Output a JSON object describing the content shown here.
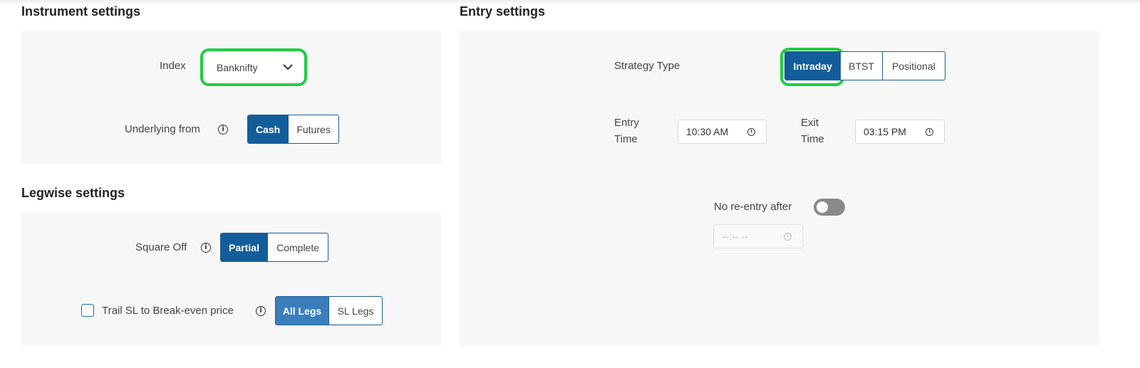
{
  "instrument": {
    "title": "Instrument settings",
    "index_label": "Index",
    "index_value": "Banknifty",
    "underlying_label": "Underlying from",
    "underlying_options": [
      "Cash",
      "Futures"
    ],
    "underlying_selected": "Cash"
  },
  "legwise": {
    "title": "Legwise settings",
    "square_off_label": "Square Off",
    "square_off_options": [
      "Partial",
      "Complete"
    ],
    "square_off_selected": "Partial",
    "trail_label": "Trail SL to Break-even price",
    "trail_checked": false,
    "trail_options": [
      "All Legs",
      "SL Legs"
    ],
    "trail_selected": "All Legs"
  },
  "entry": {
    "title": "Entry settings",
    "strategy_label": "Strategy Type",
    "strategy_options": [
      "Intraday",
      "BTST",
      "Positional"
    ],
    "strategy_selected": "Intraday",
    "entry_time_label_1": "Entry",
    "entry_time_label_2": "Time",
    "entry_time_value": "10:30 AM",
    "exit_time_label_1": "Exit",
    "exit_time_label_2": "Time",
    "exit_time_value": "03:15 PM",
    "no_reentry_label": "No re-entry after",
    "no_reentry_enabled": false,
    "no_reentry_placeholder": "--:-- --"
  },
  "colors": {
    "accent": "#125d9a",
    "highlight": "#22cc44",
    "panel_bg": "#f7f7f7"
  },
  "icons": {
    "info": "info-icon",
    "dropdown": "chevron-down-icon",
    "clock": "clock-icon"
  }
}
